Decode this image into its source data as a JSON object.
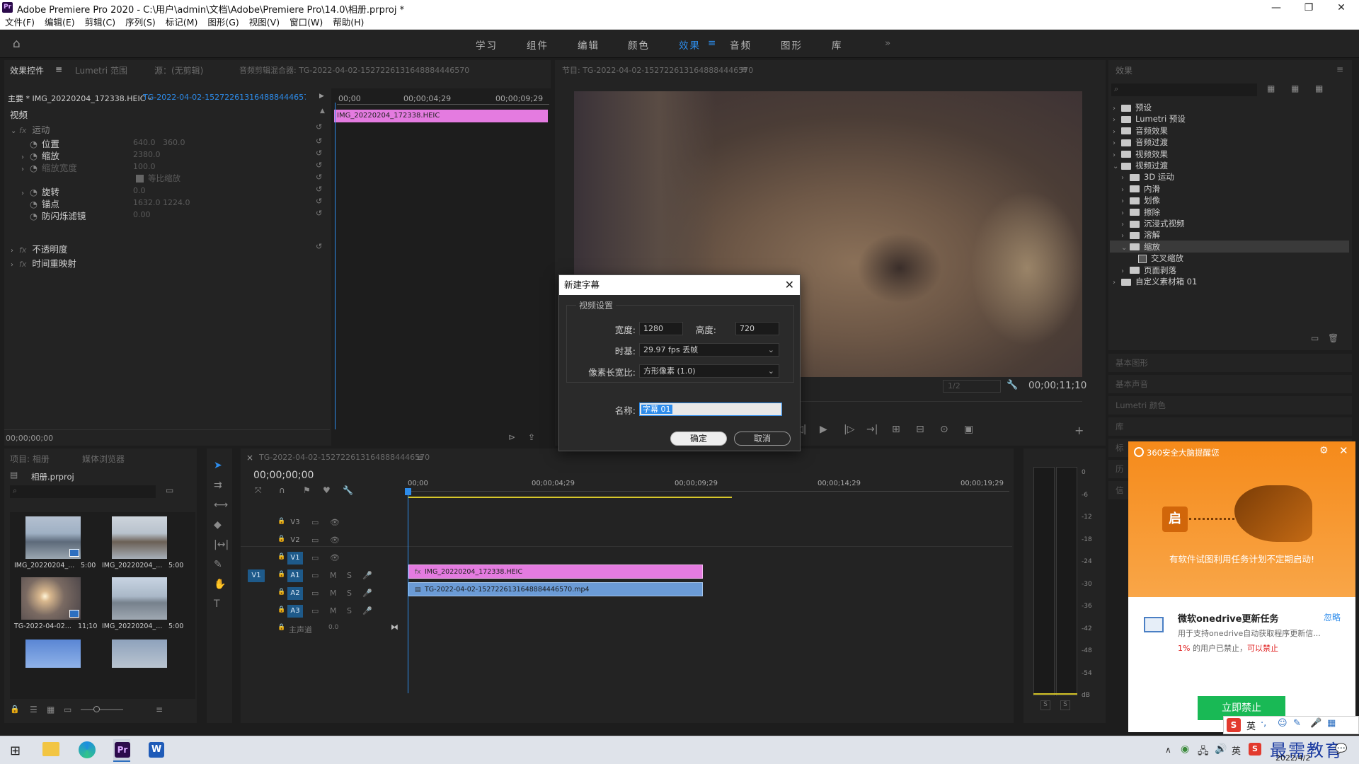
{
  "window": {
    "title": "Adobe Premiere Pro 2020 - C:\\用户\\admin\\文档\\Adobe\\Premiere Pro\\14.0\\相册.prproj *",
    "app_icon": "Pr",
    "controls": [
      "—",
      "❐",
      "✕"
    ]
  },
  "menu": [
    "文件(F)",
    "编辑(E)",
    "剪辑(C)",
    "序列(S)",
    "标记(M)",
    "图形(G)",
    "视图(V)",
    "窗口(W)",
    "帮助(H)"
  ],
  "workspaces": {
    "items": [
      "学习",
      "组件",
      "编辑",
      "颜色",
      "效果",
      "音频",
      "图形",
      "库"
    ],
    "active": "效果",
    "more": "»"
  },
  "effect_controls": {
    "tabs": [
      "效果控件",
      "Lumetri 范围",
      "源：(无剪辑)",
      "音频剪辑混合器: TG-2022-04-02-152722613164888444657​0"
    ],
    "master": "主要 * IMG_20220204_172338.HEIC",
    "sequence": "TG-2022-04-02-152722613164888444657...",
    "ruler": [
      "00;00",
      "00;00;04;29",
      "00;00;09;29"
    ],
    "clip_label": "IMG_20220204_172338.HEIC",
    "section_video": "视频",
    "motion": "运动",
    "rows": [
      {
        "label": "位置",
        "v1": "640.0",
        "v2": "360.0"
      },
      {
        "label": "缩放",
        "v1": "2380.0",
        "v2": ""
      },
      {
        "label": "缩放宽度",
        "v1": "100.0",
        "v2": ""
      },
      {
        "label": "等比缩放",
        "v1": "",
        "v2": ""
      },
      {
        "label": "旋转",
        "v1": "0.0",
        "v2": ""
      },
      {
        "label": "锚点",
        "v1": "1632.0",
        "v2": "1224.0"
      },
      {
        "label": "防闪烁滤镜",
        "v1": "0.00",
        "v2": ""
      }
    ],
    "opacity": "不透明度",
    "timeremap": "时间重映射",
    "timecode": "00;00;00;00",
    "fx": "fx"
  },
  "program": {
    "title": "节目: TG-2022-04-02-152722613164888444657​0",
    "timecode": "00;00;11;10",
    "fraction": "1/2"
  },
  "effects_panel": {
    "title": "效果",
    "tree": [
      {
        "label": "预设",
        "level": 0,
        "open": false,
        "type": "star"
      },
      {
        "label": "Lumetri 预设",
        "level": 0,
        "open": false,
        "type": "star"
      },
      {
        "label": "音频效果",
        "level": 0,
        "open": false,
        "type": "folder"
      },
      {
        "label": "音频过渡",
        "level": 0,
        "open": false,
        "type": "folder"
      },
      {
        "label": "视频效果",
        "level": 0,
        "open": false,
        "type": "folder"
      },
      {
        "label": "视频过渡",
        "level": 0,
        "open": true,
        "type": "folder"
      },
      {
        "label": "3D 运动",
        "level": 1,
        "open": false,
        "type": "folder"
      },
      {
        "label": "内滑",
        "level": 1,
        "open": false,
        "type": "folder"
      },
      {
        "label": "划像",
        "level": 1,
        "open": false,
        "type": "folder"
      },
      {
        "label": "擦除",
        "level": 1,
        "open": false,
        "type": "folder"
      },
      {
        "label": "沉浸式视频",
        "level": 1,
        "open": false,
        "type": "folder"
      },
      {
        "label": "溶解",
        "level": 1,
        "open": false,
        "type": "folder"
      },
      {
        "label": "缩放",
        "level": 1,
        "open": true,
        "type": "folder"
      },
      {
        "label": "交叉缩放",
        "level": 2,
        "open": false,
        "type": "effect"
      },
      {
        "label": "页面剥落",
        "level": 1,
        "open": false,
        "type": "folder"
      },
      {
        "label": "自定义素材箱 01",
        "level": 0,
        "open": false,
        "type": "folder"
      }
    ],
    "collapsed_panels": [
      "基本图形",
      "基本声音",
      "Lumetri 颜色",
      "库",
      "标",
      "历",
      "信"
    ]
  },
  "project": {
    "tabs": [
      "项目: 相册",
      "媒体浏览器"
    ],
    "name": "相册.prproj",
    "items": [
      {
        "name": "IMG_20220204_...",
        "dur": "5:00"
      },
      {
        "name": "IMG_20220204_...",
        "dur": "5:00"
      },
      {
        "name": "TG-2022-04-02...",
        "dur": "11;10"
      },
      {
        "name": "IMG_20220204_...",
        "dur": "5:00"
      }
    ]
  },
  "timeline": {
    "tab": "TG-2022-04-02-152722613164888444657​0",
    "timecode": "00;00;00;00",
    "ruler": [
      "00;00",
      "00;00;04;29",
      "00;00;09;29",
      "00;00;14;29",
      "00;00;19;29"
    ],
    "tracks": [
      "V3",
      "V2",
      "V1",
      "A1",
      "A2",
      "A3"
    ],
    "source_v1": "V1",
    "master": "主声道",
    "master_val": "0.0",
    "clip_v2": "IMG_20220204_172338.HEIC",
    "clip_v1": "TG-2022-04-02-152722613164888444657​0.mp4",
    "fx": "fx",
    "m": "M",
    "s": "S"
  },
  "meter": {
    "labels": [
      "0",
      "-6",
      "-12",
      "-18",
      "-24",
      "-30",
      "-36",
      "-42",
      "-48",
      "-54",
      "dB"
    ],
    "solo": [
      "S",
      "S"
    ]
  },
  "dialog": {
    "title": "新建字幕",
    "group": "视频设置",
    "width_label": "宽度:",
    "width": "1280",
    "height_label": "高度:",
    "height": "720",
    "timebase_label": "时基:",
    "timebase": "29.97 fps 丢帧",
    "par_label": "像素长宽比:",
    "par": "方形像素 (1.0)",
    "name_label": "名称:",
    "name": "字幕 01",
    "ok": "确定",
    "cancel": "取消"
  },
  "popup": {
    "brand": "360安全大脑提醒您",
    "headline": "有软件试图利用任务计划不定期启动!",
    "badge": "启",
    "task_title": "微软onedrive更新任务",
    "ignore": "忽略",
    "desc": "用于支持onedrive自动获取程序更新信...",
    "stat_pct": "1%",
    "stat_text": "的用户已禁止，",
    "stat_link": "可以禁止",
    "action": "立即禁止"
  },
  "taskbar": {
    "apps": [
      "Pr",
      "W"
    ],
    "ime": "英",
    "watermark": "最需教育",
    "date": "2022/4/2"
  },
  "colors": {
    "accent": "#2d8ceb",
    "clip_pink": "#e47be0",
    "clip_blue": "#6b9bd6",
    "popup_orange": "#f7941d",
    "action_green": "#19b955"
  }
}
